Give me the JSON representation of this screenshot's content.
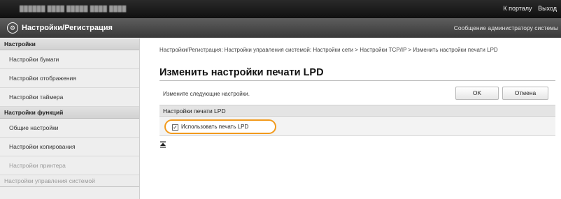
{
  "topbar": {
    "model": "██████  ████ █████ ████ ████",
    "to_portal": "К порталу",
    "logout": "Выход"
  },
  "header": {
    "title": "Настройки/Регистрация",
    "admin_message": "Сообщение администратору системы"
  },
  "sidebar": {
    "group1_title": "Настройки",
    "group1_items": [
      "Настройки бумаги",
      "Настройки отображения",
      "Настройки таймера"
    ],
    "group2_title": "Настройки функций",
    "group2_items": [
      "Общие настройки",
      "Настройки копирования",
      "Настройки принтера"
    ],
    "group3_title": "Настройки управления системой"
  },
  "main": {
    "breadcrumb": "Настройки/Регистрация: Настройки управления системой: Настройки сети > Настройки TCP/IP > Изменить настройки печати LPD",
    "page_title": "Изменить настройки печати LPD",
    "instruction": "Измените следующие настройки.",
    "ok_label": "OK",
    "cancel_label": "Отмена",
    "section_title": "Настройки печати LPD",
    "use_lpd_label": "Использовать печать LPD",
    "use_lpd_checked": true,
    "highlight_color": "#f29a1c"
  }
}
